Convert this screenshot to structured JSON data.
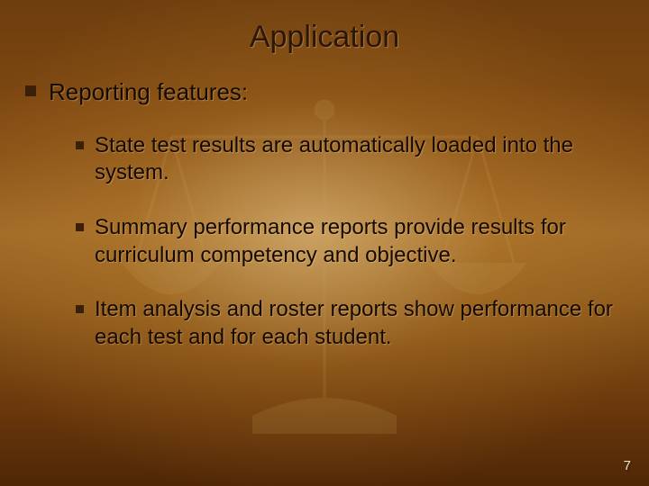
{
  "title": "Application",
  "lvl1": "Reporting features:",
  "items": [
    "State test results are automatically loaded into the system.",
    "Summary performance reports provide results for curriculum competency and objective.",
    "Item analysis and roster reports show performance for each test and for each student."
  ],
  "page_number": "7"
}
